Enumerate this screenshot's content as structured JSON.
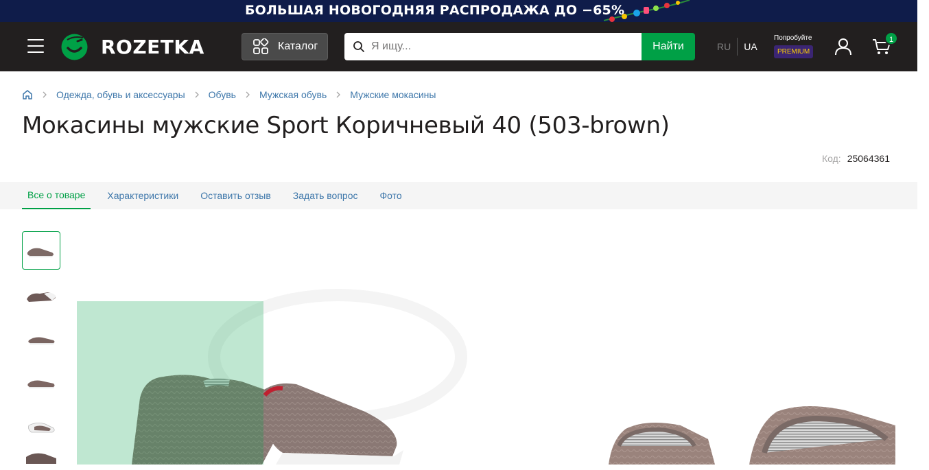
{
  "promo": {
    "text": "БОЛЬШАЯ НОВОГОДНЯЯ РАСПРОДАЖА ДО −65%"
  },
  "header": {
    "logo_text": "ROZETKA",
    "catalog_label": "Каталог",
    "search": {
      "placeholder": "Я ищу...",
      "value": ""
    },
    "search_button": "Найти",
    "lang_ru": "RU",
    "lang_ua": "UA",
    "premium_try": "Попробуйте",
    "premium_badge": "PREMIUM",
    "cart_count": "1"
  },
  "breadcrumbs": [
    "Одежда, обувь и аксессуары",
    "Обувь",
    "Мужская обувь",
    "Мужские мокасины"
  ],
  "product": {
    "title": "Мокасины мужские Sport Коричневый 40 (503-brown)",
    "code_label": "Код:",
    "code_value": "25064361"
  },
  "tabs": [
    {
      "label": "Все о товаре",
      "active": true
    },
    {
      "label": "Характеристики",
      "active": false
    },
    {
      "label": "Оставить отзыв",
      "active": false
    },
    {
      "label": "Задать вопрос",
      "active": false
    },
    {
      "label": "Фото",
      "active": false
    }
  ],
  "gallery": {
    "thumbnail_count": 6,
    "active_thumbnail": 0
  },
  "colors": {
    "brand_green": "#00a046",
    "header_bg": "#221f1f",
    "promo_bg": "#0f1c4a",
    "link_blue": "#3e77aa",
    "premium_bg": "#3b2573",
    "premium_text": "#ffd200"
  }
}
